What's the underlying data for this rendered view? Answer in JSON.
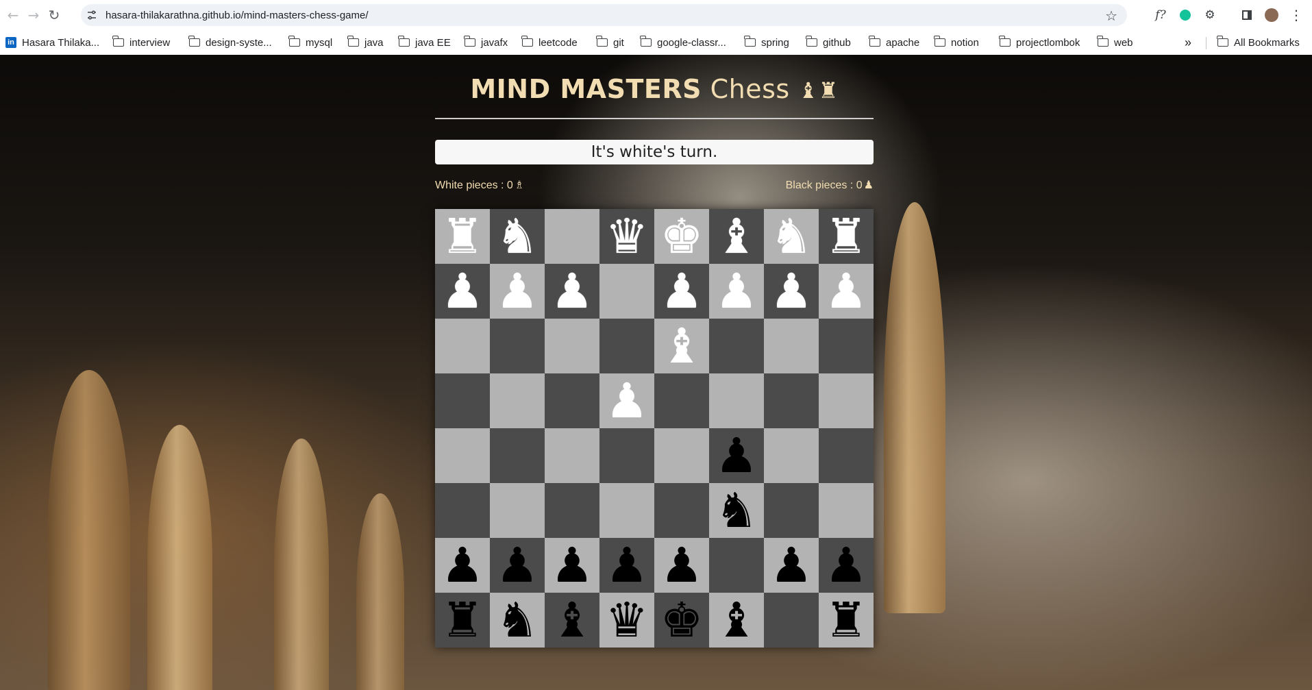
{
  "browser": {
    "url": "hasara-thilakarathna.github.io/mind-masters-chess-game/",
    "bookmarks": [
      {
        "label": "Hasara Thilaka...",
        "icon": "linkedin-icon"
      },
      {
        "label": "interview",
        "icon": "folder-icon"
      },
      {
        "label": "design-syste...",
        "icon": "folder-icon"
      },
      {
        "label": "mysql",
        "icon": "folder-icon"
      },
      {
        "label": "java",
        "icon": "folder-icon"
      },
      {
        "label": "java EE",
        "icon": "folder-icon"
      },
      {
        "label": "javafx",
        "icon": "folder-icon"
      },
      {
        "label": "leetcode",
        "icon": "folder-icon"
      },
      {
        "label": "git",
        "icon": "folder-icon"
      },
      {
        "label": "google-classr...",
        "icon": "folder-icon"
      },
      {
        "label": "spring",
        "icon": "folder-icon"
      },
      {
        "label": "github",
        "icon": "folder-icon"
      },
      {
        "label": "apache",
        "icon": "folder-icon"
      },
      {
        "label": "notion",
        "icon": "folder-icon"
      },
      {
        "label": "projectlombok",
        "icon": "folder-icon"
      },
      {
        "label": "web",
        "icon": "folder-icon"
      }
    ],
    "overflow_glyph": "»",
    "all_bookmarks": "All Bookmarks"
  },
  "game": {
    "title_bold": "MIND MASTERS",
    "title_rest": "Chess",
    "title_glyph": "♝♜",
    "status": "It's white's turn.",
    "white_count_label": "White pieces : 0",
    "white_count_glyph": "♗",
    "black_count_label": "Black pieces : 0",
    "black_count_glyph": "♟"
  },
  "board": {
    "rows": [
      [
        "wR",
        "wN",
        "",
        "wQ",
        "wK",
        "wB",
        "wN",
        "wR"
      ],
      [
        "wP",
        "wP",
        "wP",
        "",
        "wP",
        "wP",
        "wP",
        "wP"
      ],
      [
        "",
        "",
        "",
        "",
        "wB",
        "",
        "",
        ""
      ],
      [
        "",
        "",
        "",
        "wP",
        "",
        "",
        "",
        ""
      ],
      [
        "",
        "",
        "",
        "",
        "",
        "bP",
        "",
        ""
      ],
      [
        "",
        "",
        "",
        "",
        "",
        "bN",
        "",
        ""
      ],
      [
        "bP",
        "bP",
        "bP",
        "bP",
        "bP",
        "",
        "bP",
        "bP"
      ],
      [
        "bR",
        "bN",
        "bB",
        "bQ",
        "bK",
        "bB",
        "",
        "bR"
      ]
    ],
    "glyphs": {
      "R": "♜",
      "N": "♞",
      "B": "♝",
      "Q": "♛",
      "K": "♚",
      "P": "♟"
    },
    "piece_names": {
      "R": "rook",
      "N": "knight",
      "B": "bishop",
      "Q": "queen",
      "K": "king",
      "P": "pawn"
    },
    "colors": {
      "light": "#b3b3b3",
      "dark": "#4b4b4b",
      "white": "#ffffff",
      "black": "#000000"
    }
  }
}
